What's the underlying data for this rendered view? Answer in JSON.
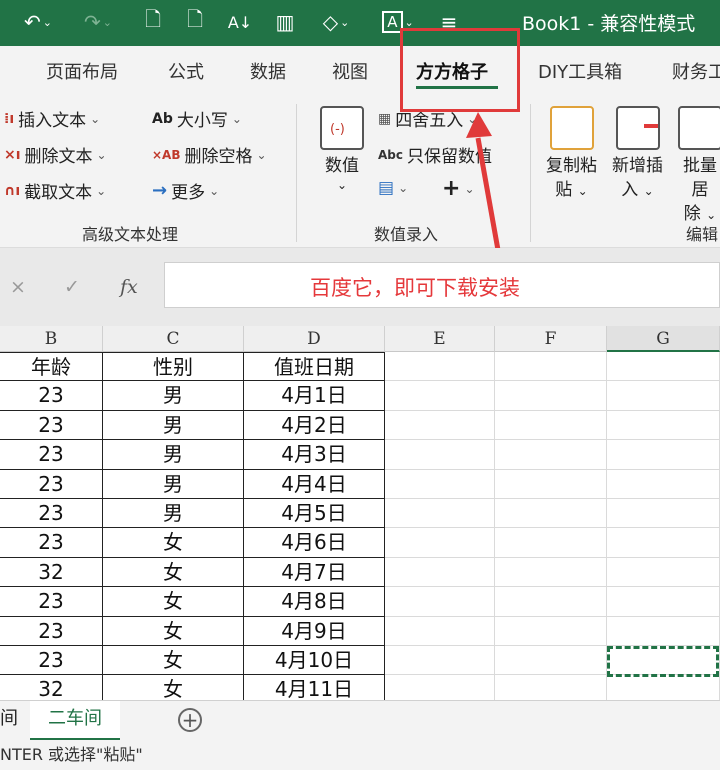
{
  "window": {
    "title": "Book1  -  兼容性模式"
  },
  "quick_access": [
    {
      "name": "undo-icon",
      "glyph": "↶"
    },
    {
      "name": "redo-icon",
      "glyph": "↷"
    },
    {
      "name": "file-icon",
      "glyph": "🗋"
    },
    {
      "name": "sort-icon",
      "glyph": "A↓"
    },
    {
      "name": "chart-icon",
      "glyph": "▥"
    },
    {
      "name": "shapes-icon",
      "glyph": "◇"
    },
    {
      "name": "textbox-icon",
      "glyph": "A"
    },
    {
      "name": "customize-icon",
      "glyph": "≡"
    }
  ],
  "tabs": [
    "页面布局",
    "公式",
    "数据",
    "视图",
    "方方格子",
    "DIY工具箱",
    "财务工"
  ],
  "active_tab": "方方格子",
  "ribbon": {
    "text_group": {
      "items": [
        "插入文本",
        "删除文本",
        "截取文本"
      ],
      "items2": [
        "大小写",
        "删除空格",
        "更多"
      ],
      "icons2": [
        "Ab",
        "×AB",
        "→"
      ],
      "label": "高级文本处理"
    },
    "number_group": {
      "big_button": [
        "数值"
      ],
      "round": "四舍五入",
      "keep_num": "只保留数值",
      "abc_icon": "Abc",
      "plus": "+",
      "label": "数值录入"
    },
    "edit_group": {
      "buttons": [
        {
          "line1": "复制粘",
          "line2": "贴"
        },
        {
          "line1": "新增插",
          "line2": "入"
        },
        {
          "line1": "批量居",
          "line2": "除"
        }
      ],
      "label": "编辑"
    }
  },
  "formula_bar": {
    "cancel": "×",
    "confirm": "✓",
    "fx": "fx",
    "content": "百度它，即可下载安装"
  },
  "columns": [
    "B",
    "C",
    "D",
    "E",
    "F",
    "G"
  ],
  "table": {
    "headers": [
      "年龄",
      "性别",
      "值班日期"
    ],
    "rows": [
      [
        "23",
        "男",
        "4月1日"
      ],
      [
        "23",
        "男",
        "4月2日"
      ],
      [
        "23",
        "男",
        "4月3日"
      ],
      [
        "23",
        "男",
        "4月4日"
      ],
      [
        "23",
        "男",
        "4月5日"
      ],
      [
        "23",
        "女",
        "4月6日"
      ],
      [
        "32",
        "女",
        "4月7日"
      ],
      [
        "23",
        "女",
        "4月8日"
      ],
      [
        "23",
        "女",
        "4月9日"
      ],
      [
        "23",
        "女",
        "4月10日"
      ],
      [
        "32",
        "女",
        "4月11日"
      ]
    ]
  },
  "sheets": {
    "prev": "间",
    "active": "二车间",
    "add": "+"
  },
  "status": "NTER 或选择\"粘贴\"",
  "colors": {
    "accent": "#217346",
    "highlight": "#e03a3a",
    "formula_text": "#e5383b"
  }
}
